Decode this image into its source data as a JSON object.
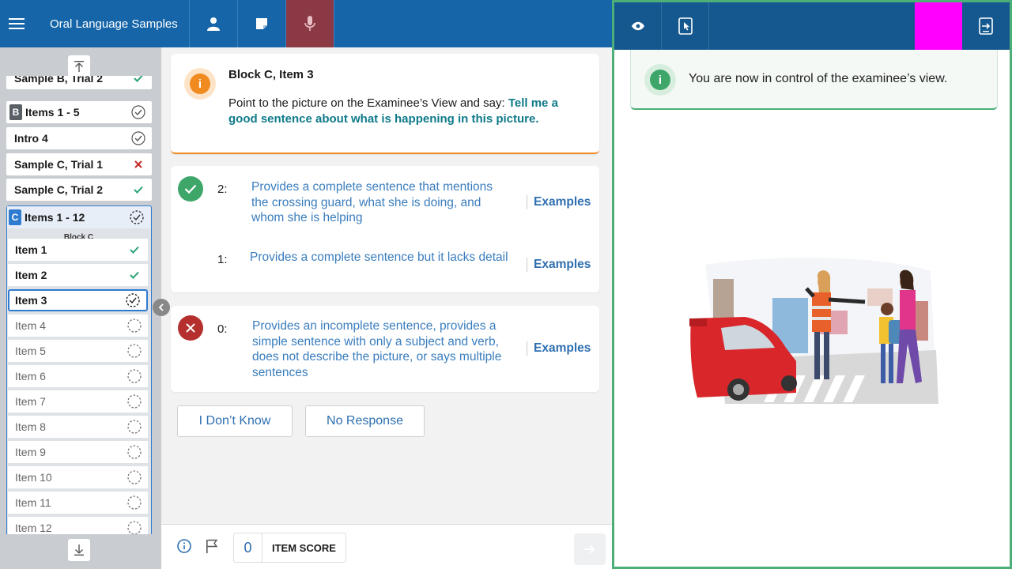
{
  "app": {
    "title": "Oral Language Samples"
  },
  "colors": {
    "primary": "#1565a8",
    "active_tab": "#8b3a45",
    "warning": "#f08b1f",
    "success": "#3fa66a",
    "error": "#c62828",
    "accent_link": "#2f6fb0",
    "prompt_highlight": "#0f7a8a"
  },
  "topbar": {
    "icons": [
      "menu-icon",
      "person-icon",
      "note-icon",
      "microphone-icon"
    ]
  },
  "sidebar": {
    "items": [
      {
        "label": "Sample B, Trial 2",
        "status": "correct"
      },
      {
        "label": "Items 1 - 5",
        "badge": "B",
        "status": "complete"
      },
      {
        "label": "Intro 4",
        "status": "complete"
      },
      {
        "label": "Sample C, Trial 1",
        "status": "incorrect"
      },
      {
        "label": "Sample C, Trial 2",
        "status": "correct"
      }
    ],
    "block": {
      "badge": "C",
      "label": "Items 1 - 12",
      "sublabel": "Block C",
      "items": [
        {
          "label": "Item 1",
          "status": "correct"
        },
        {
          "label": "Item 2",
          "status": "correct"
        },
        {
          "label": "Item 3",
          "status": "current"
        },
        {
          "label": "Item 4",
          "status": "pending"
        },
        {
          "label": "Item 5",
          "status": "pending"
        },
        {
          "label": "Item 6",
          "status": "pending"
        },
        {
          "label": "Item 7",
          "status": "pending"
        },
        {
          "label": "Item 8",
          "status": "pending"
        },
        {
          "label": "Item 9",
          "status": "pending"
        },
        {
          "label": "Item 10",
          "status": "pending"
        },
        {
          "label": "Item 11",
          "status": "pending"
        },
        {
          "label": "Item 12",
          "status": "pending"
        }
      ]
    }
  },
  "prompt": {
    "title": "Block C, Item 3",
    "instruction": "Point to the picture on the Examinee’s View and say: ",
    "say": "Tell me a good sentence about what is happening in this picture."
  },
  "scoring": {
    "options": [
      {
        "score": "2:",
        "desc": "Provides a complete sentence that mentions the crossing guard, what she is doing, and whom she is helping",
        "examples": "Examples"
      },
      {
        "score": "1:",
        "desc": "Provides a complete sentence but it lacks detail",
        "examples": "Examples"
      },
      {
        "score": "0:",
        "desc": "Provides an incomplete sentence, provides a simple sentence with only a subject and verb, does not describe the picture, or says multiple sentences",
        "examples": "Examples"
      }
    ]
  },
  "actions": {
    "dont_know": "I Don’t Know",
    "no_response": "No Response"
  },
  "footer": {
    "score_value": "0",
    "score_label": "ITEM SCORE"
  },
  "examinee": {
    "notice": "You are now in control of the examinee’s view.",
    "toolbar_icons": [
      "eye-icon",
      "tablet-pointer-icon",
      "exit-screen-icon"
    ]
  }
}
